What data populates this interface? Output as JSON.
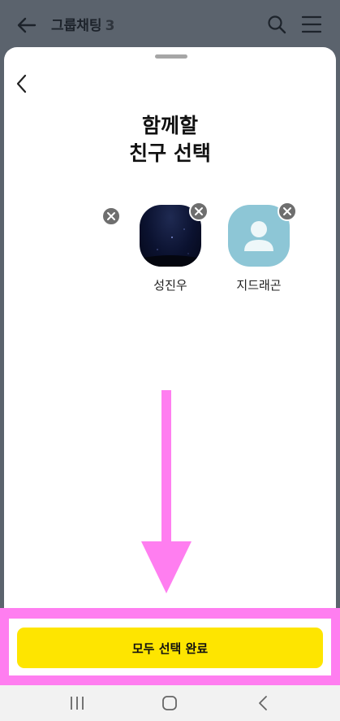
{
  "header": {
    "title": "그룹채팅",
    "count": "3"
  },
  "sheet": {
    "heading_line1": "함께할",
    "heading_line2": "친구 선택"
  },
  "selected_friends": [
    {
      "name": "성진우",
      "avatar": "night-sky-photo"
    },
    {
      "name": "지드래곤",
      "avatar": "default-profile-icon"
    }
  ],
  "footer": {
    "done_label": "모두 선택 완료"
  },
  "colors": {
    "accent": "#fee500",
    "annotation": "#ff7ef0",
    "avatar_default": "#8dc6d6"
  },
  "icons": [
    "back-arrow-icon",
    "search-icon",
    "hamburger-menu-icon",
    "chevron-left-icon",
    "close-icon",
    "person-icon",
    "recent-apps-icon",
    "home-icon",
    "back-icon"
  ]
}
